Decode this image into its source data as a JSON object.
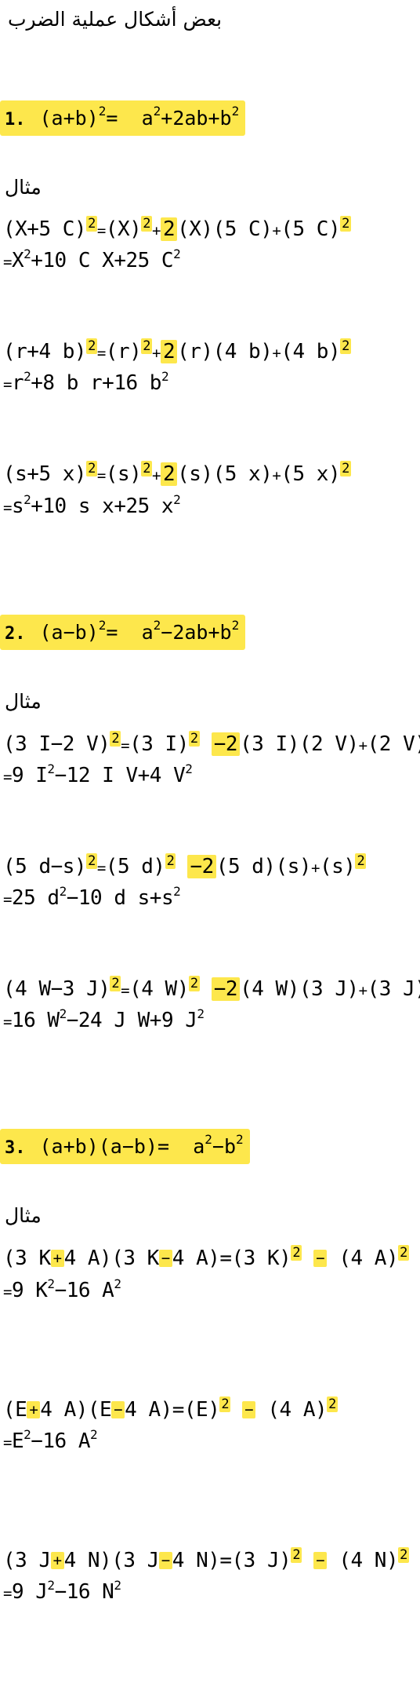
{
  "title": "بعض أشكال عملية الضرب",
  "example_label": "مثال",
  "sections": [
    {
      "number": "1.",
      "formula_lhs": "(a+b)",
      "formula_rhs": "a",
      "formula_tail": "+2ab+b",
      "examples": [
        {
          "line1": "(X+5 C)",
          "line2": "=X²+10 C X+25 C²",
          "x": "X",
          "y": "5 C",
          "result_a": "X",
          "result_b": "+10 C X+25 C"
        },
        {
          "line1": "(r+4 b)",
          "x": "r",
          "y": "4 b",
          "result_a": "r",
          "result_b": "+8 b r+16 b"
        },
        {
          "line1": "(s+5 x)",
          "x": "s",
          "y": "5 x",
          "result_a": "s",
          "result_b": "+10 s x+25 x"
        }
      ]
    },
    {
      "number": "2.",
      "formula_lhs": "(a−b)",
      "formula_rhs": "a",
      "formula_tail": "−2ab+b",
      "examples": [
        {
          "line1": "(3 I−2 V)",
          "x": "3 I",
          "y": "2 V",
          "result_a": "9 I",
          "result_b": "−12 I V+4 V"
        },
        {
          "line1": "(5 d−s)",
          "x": "5 d",
          "y": "s",
          "result_a": "25 d",
          "result_b": "−10 d s+s"
        },
        {
          "line1": "(4 W−3 J)",
          "x": "4 W",
          "y": "3 J",
          "result_a": "16 W",
          "result_b": "−24 J W+9 J"
        }
      ]
    },
    {
      "number": "3.",
      "formula_text": "(a+b)(a−b)=",
      "formula_rhs": "a",
      "formula_tail": "−b",
      "examples": [
        {
          "p1": "(3 K",
          "p2": "4 A)(3 K",
          "p3": "4 A)=(3 K)",
          "p4": "(4 A)",
          "result_a": "9 K",
          "result_b": "−16 A"
        },
        {
          "p1": "(E",
          "p2": "4 A)(E",
          "p3": "4 A)=(E)",
          "p4": "(4 A)",
          "result_a": "E",
          "result_b": "−16 A"
        },
        {
          "p1": "(3 J",
          "p2": "4 N)(3 J",
          "p3": "4 N)=(3 J)",
          "p4": "(4 N)",
          "result_a": "9 J",
          "result_b": "−16 N"
        }
      ]
    }
  ],
  "symbols": {
    "sq": "2",
    "plus": "+",
    "minus": "−",
    "two": "2",
    "neg_two": "−2",
    "eq": "=",
    "times_plus": "+"
  }
}
